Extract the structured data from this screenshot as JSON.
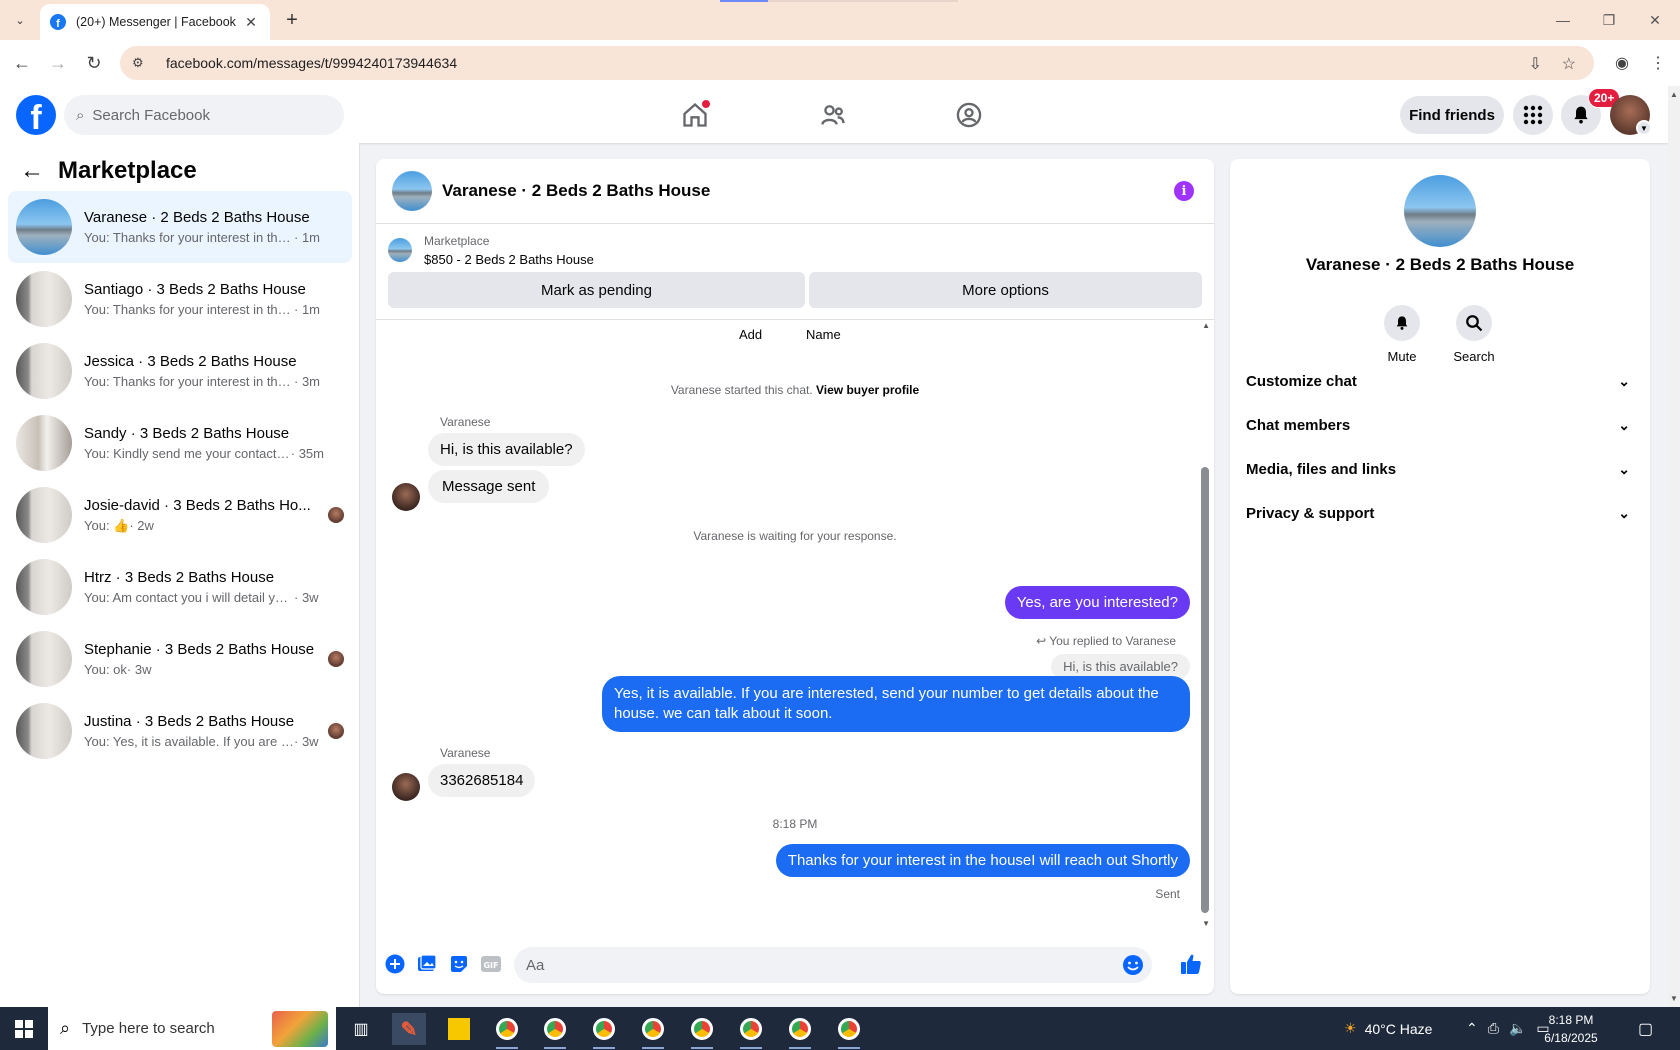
{
  "browser": {
    "tab_title": "(20+) Messenger | Facebook",
    "url": "facebook.com/messages/t/9994240173944634",
    "new_tab_symbol": "+",
    "close_symbol": "✕"
  },
  "fb": {
    "logo_letter": "f",
    "search_placeholder": "Search Facebook",
    "find_friends": "Find friends",
    "notif_count": "20+"
  },
  "sidebar": {
    "title": "Marketplace",
    "conversations": [
      {
        "name": "Varanese · 2 Beds 2 Baths House",
        "snippet": "You: Thanks for your interest in the h...",
        "time": " · 1m",
        "avatar": "house",
        "active": true
      },
      {
        "name": "Santiago · 3 Beds 2 Baths House",
        "snippet": "You: Thanks for your interest in the h...",
        "time": " · 1m",
        "avatar": "room"
      },
      {
        "name": "Jessica · 3 Beds 2 Baths House",
        "snippet": "You: Thanks for your interest in the h...",
        "time": " · 3m",
        "avatar": "room"
      },
      {
        "name": "Sandy · 3 Beds 2 Baths House",
        "snippet": "You: Kindly send me your contact n...",
        "time": " · 35m",
        "avatar": "kitchen"
      },
      {
        "name": "Josie-david · 3 Beds 2 Baths Ho...",
        "snippet": "You: 👍",
        "time": " · 2w",
        "avatar": "room",
        "seen": true
      },
      {
        "name": "Htrz · 3 Beds 2 Baths House",
        "snippet": "You: Am contact you i will detail you. ...",
        "time": " · 3w",
        "avatar": "room"
      },
      {
        "name": "Stephanie · 3 Beds 2 Baths House",
        "snippet": "You: ok",
        "time": " · 3w",
        "avatar": "room",
        "seen": true
      },
      {
        "name": "Justina · 3 Beds 2 Baths House",
        "snippet": "You: Yes, it is available. If you are in...",
        "time": " · 3w",
        "avatar": "room",
        "seen": true
      }
    ]
  },
  "chat": {
    "title": "Varanese · 2 Beds 2 Baths House",
    "info_symbol": "i",
    "marketplace_label": "Marketplace",
    "listing": "$850 - 2 Beds 2 Baths House",
    "mark_pending": "Mark as pending",
    "more_options": "More options",
    "top_add": "Add",
    "top_name": "Name",
    "started_note": "Varanese started this chat.",
    "view_buyer": "View buyer profile",
    "sender1": "Varanese",
    "msg1": "Hi, is this available?",
    "msg2": "Message sent",
    "waiting_note": "Varanese is waiting for your response.",
    "out1": "Yes, are you interested?",
    "replied_label": "You replied to Varanese",
    "reply_quote": "Hi, is this available?",
    "out2": "Yes, it is available. If you are interested, send your number to get details about the house. we can talk about it soon.",
    "sender2": "Varanese",
    "msg3": "3362685184",
    "timestamp": "8:18 PM",
    "out3": "Thanks for your interest in the houseI will reach out Shortly",
    "sent_label": "Sent",
    "composer_placeholder": "Aa"
  },
  "rpanel": {
    "title": "Varanese · 2 Beds 2 Baths House",
    "mute": "Mute",
    "search": "Search",
    "rows": [
      "Customize chat",
      "Chat members",
      "Media, files and links",
      "Privacy & support"
    ]
  },
  "taskbar": {
    "search_placeholder": "Type here to search",
    "weather": "40°C  Haze",
    "time": "8:18 PM",
    "date": "6/18/2025"
  },
  "colors": {
    "fb_blue": "#0866ff",
    "out_bubble_purple": "#6a39f3",
    "out_bubble_blue": "#1b6cf2",
    "info_purple": "#a033ff"
  }
}
